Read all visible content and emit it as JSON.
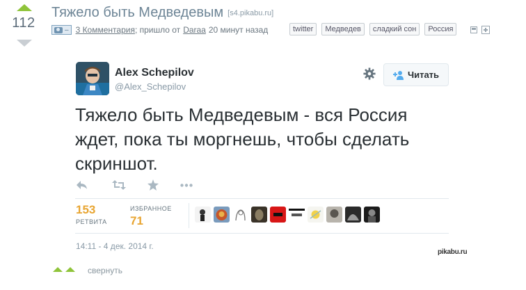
{
  "post": {
    "rating": "112",
    "title": "Тяжело быть Медведевым",
    "source": "[s4.pikabu.ru]",
    "type_badge": "–",
    "comments_link": "3 Комментария",
    "meta_mid": "; пришло от",
    "author_link": "Daraa",
    "time": "20 минут назад",
    "tags": [
      "twitter",
      "Медведев",
      "сладкий сон",
      "Россия"
    ]
  },
  "tweet": {
    "author_name": "Alex Schepilov",
    "author_handle": "@Alex_Schepilov",
    "follow_label": "Читать",
    "text": "Тяжело быть Медведевым - вся Россия ждет, пока ты моргнешь, чтобы сделать скриншот.",
    "retweets_count": "153",
    "retweets_label": "РЕТВИТА",
    "favorites_label": "ИЗБРАННОЕ",
    "favorites_count": "71",
    "timestamp": "14:11 - 4 дек. 2014 г."
  },
  "footer": {
    "watermark": "pikabu.ru",
    "collapse_label": "свернуть"
  },
  "colors": {
    "accent_green": "#8fc43a",
    "title_blue": "#6d8596",
    "stat_orange": "#e8a532",
    "tweet_text": "#292f33"
  },
  "icons": [
    "camera-icon",
    "save-icon",
    "expand-icon",
    "gear-icon",
    "follow-user-icon",
    "reply-icon",
    "retweet-icon",
    "favorite-icon",
    "more-icon"
  ]
}
